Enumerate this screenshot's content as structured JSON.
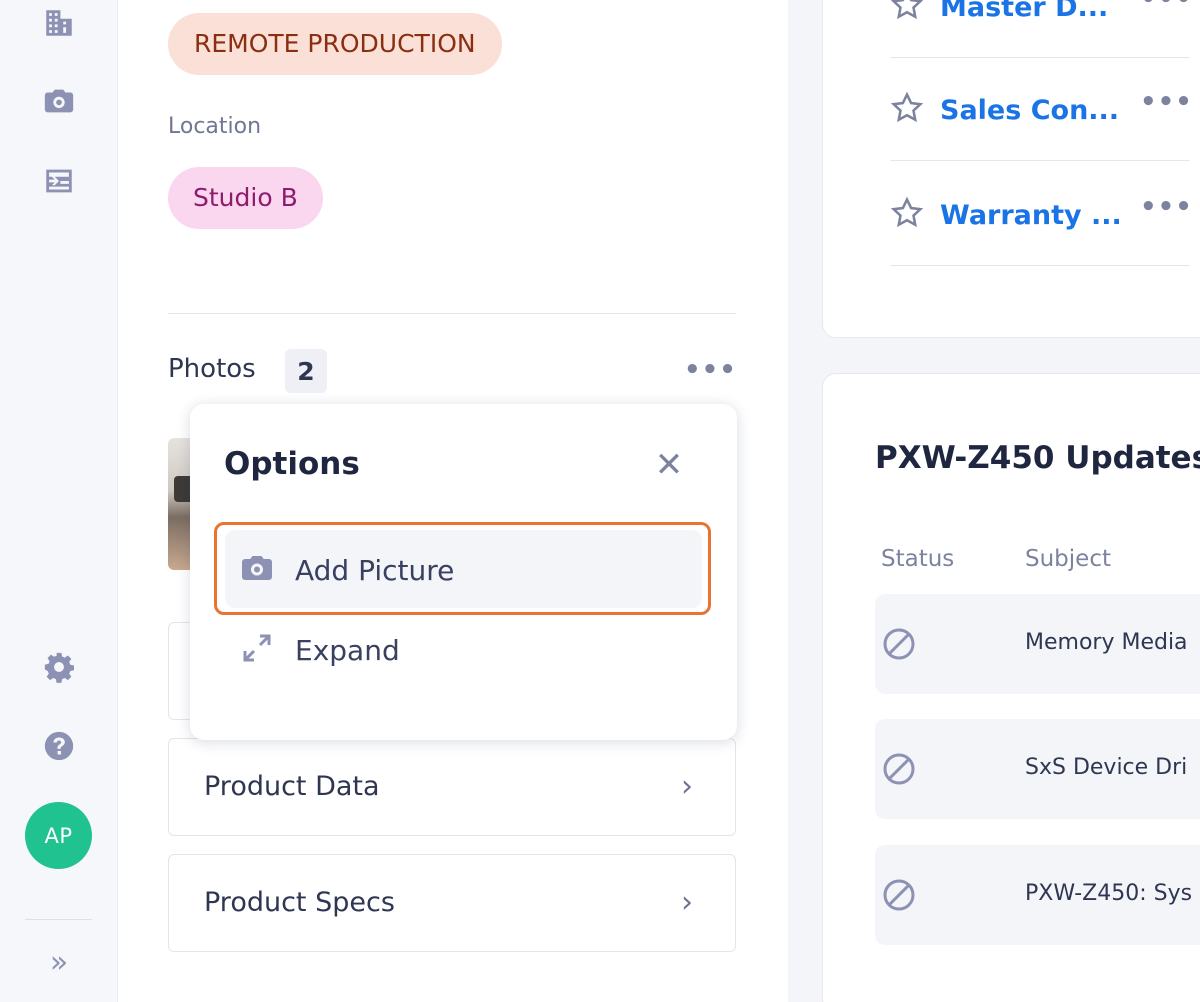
{
  "sidebar": {
    "icons": [
      "building-icon",
      "camera-icon",
      "list-icon",
      "gear-icon",
      "help-icon"
    ],
    "avatar_initials": "AP",
    "expand_glyph": "»",
    "avatar_color": "#20c38f"
  },
  "details": {
    "tag": "REMOTE PRODUCTION",
    "location_label": "Location",
    "location_value": "Studio B",
    "photos_label": "Photos",
    "photos_count": "2",
    "more_glyph": "•••",
    "accordions": [
      {
        "label": "Product Data",
        "chevron": "›"
      },
      {
        "label": "Product Specs",
        "chevron": "›"
      }
    ]
  },
  "options_menu": {
    "title": "Options",
    "close_glyph": "✕",
    "items": [
      {
        "label": "Add Picture",
        "icon": "camera-icon"
      },
      {
        "label": "Expand",
        "icon": "expand-icon"
      }
    ],
    "highlight_color": "#e97332"
  },
  "documents": {
    "items": [
      {
        "label": "Master D..."
      },
      {
        "label": "Sales Con..."
      },
      {
        "label": "Warranty ..."
      }
    ],
    "link_color": "#1a74e6"
  },
  "updates": {
    "title": "PXW-Z450 Updates",
    "columns": [
      "Status",
      "Subject"
    ],
    "rows": [
      {
        "status": "blocked",
        "subject": "Memory Media"
      },
      {
        "status": "blocked",
        "subject": "SxS Device Dri"
      },
      {
        "status": "blocked",
        "subject": "PXW-Z450: Sys"
      }
    ]
  }
}
